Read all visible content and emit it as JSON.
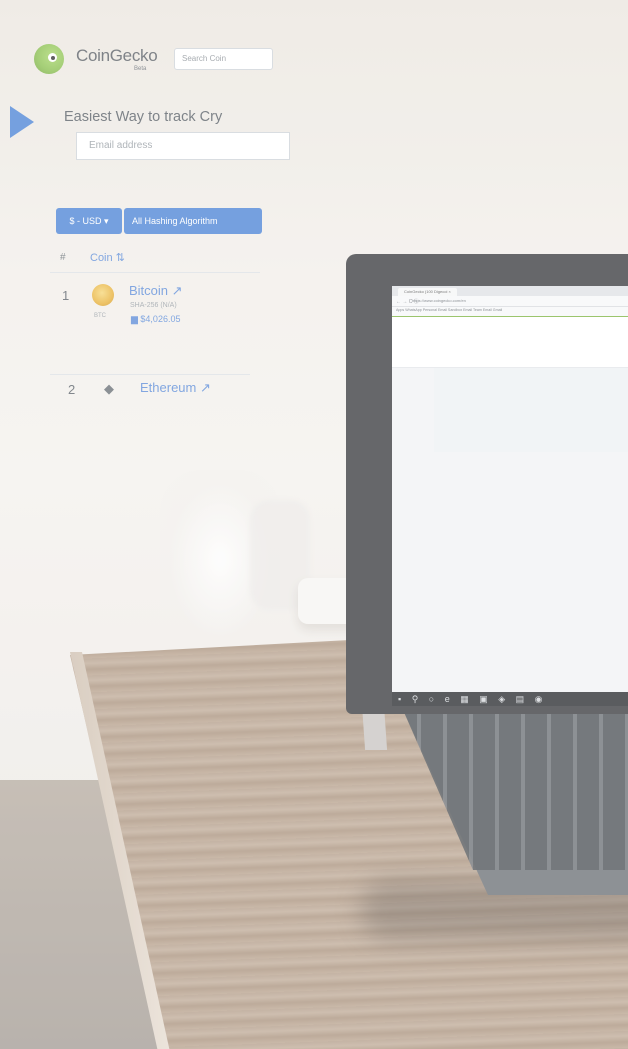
{
  "browser": {
    "tab_title": "CoinGecko (100 Digecoi ×",
    "address": "https://www.coingecko.com/en",
    "bookmarks": "Apps  WhatsApp  Personal Email  Sandbox Email  Team Email  Gmail"
  },
  "site": {
    "brand": "CoinGecko",
    "brand_sub": "Beta",
    "search_placeholder": "Search Coin",
    "hero_title": "Easiest Way to track Cry",
    "email_placeholder": "Email address"
  },
  "filters": {
    "currency_label": "$ - USD ▾",
    "algorithm_label": "All Hashing Algorithm"
  },
  "table": {
    "header_hash": "#",
    "header_coin": "Coin ⇅",
    "rows": [
      {
        "rank": "1",
        "name": "Bitcoin ↗",
        "symbol": "BTC",
        "algorithm": "SHA-256 (N/A)",
        "price": "▆ $4,026.05"
      },
      {
        "rank": "2",
        "name": "Ethereum ↗",
        "symbol_icon": "ethereum-icon"
      }
    ]
  },
  "taskbar": {
    "icons": "▪ ⚲ ○ e ▦ ▣ ◈ ▤ ◉"
  },
  "colors": {
    "accent_blue": "#4f86d6",
    "brand_green": "#8cc152",
    "laptop_bezel": "#3b3d40"
  }
}
